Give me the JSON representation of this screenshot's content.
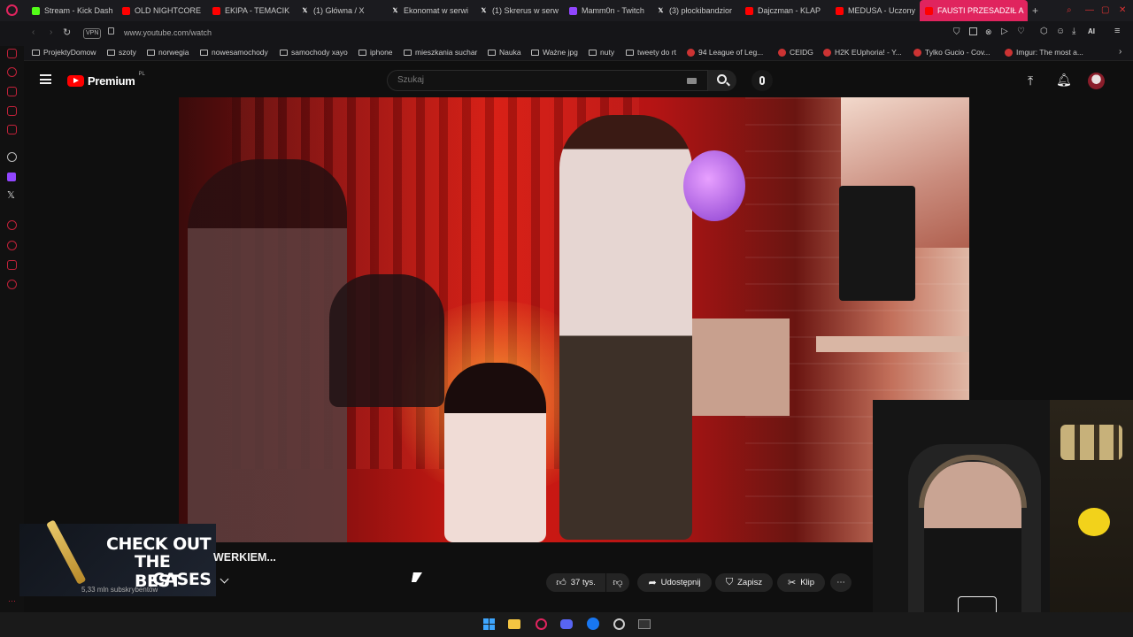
{
  "browser": {
    "tabs": [
      {
        "title": "Stream - Kick Dash",
        "icon": "kick-icon",
        "color": "#53fc18"
      },
      {
        "title": "OLD NIGHTCORE",
        "icon": "youtube-icon",
        "color": "#ff0000"
      },
      {
        "title": "EKIPA - TEMACIK",
        "icon": "youtube-icon",
        "color": "#ff0000"
      },
      {
        "title": "(1) Główna / X",
        "icon": "x-icon",
        "color": "#ffffff"
      },
      {
        "title": "Ekonomat w serwi",
        "icon": "x-icon",
        "color": "#ffffff"
      },
      {
        "title": "(1) Skrerus w serw",
        "icon": "x-icon",
        "color": "#ffffff"
      },
      {
        "title": "Mamm0n - Twitch",
        "icon": "twitch-icon",
        "color": "#9146ff"
      },
      {
        "title": "(3) płockibandzior",
        "icon": "x-icon",
        "color": "#ffffff"
      },
      {
        "title": "Dajczman - KLAP",
        "icon": "youtube-icon",
        "color": "#ff0000"
      },
      {
        "title": "MEDUSA - Uczony",
        "icon": "youtube-icon",
        "color": "#ff0000"
      },
      {
        "title": "FAUSTI PRZESADZIŁ A",
        "icon": "youtube-icon",
        "color": "#ff0000"
      }
    ],
    "new_tab": "+",
    "vpn": "VPN",
    "url": "www.youtube.com/watch",
    "ai_label": "AI",
    "bookmarks": [
      {
        "label": "ProjektyDomow",
        "type": "folder"
      },
      {
        "label": "szoty",
        "type": "folder"
      },
      {
        "label": "norwegia",
        "type": "folder"
      },
      {
        "label": "nowesamochody",
        "type": "folder"
      },
      {
        "label": "samochody xayo",
        "type": "folder"
      },
      {
        "label": "iphone",
        "type": "folder"
      },
      {
        "label": "mieszkania suchar",
        "type": "folder"
      },
      {
        "label": "Nauka",
        "type": "folder"
      },
      {
        "label": "Ważne jpg",
        "type": "folder"
      },
      {
        "label": "nuty",
        "type": "folder"
      },
      {
        "label": "tweety do rt",
        "type": "folder"
      },
      {
        "label": "94 League of Leg...",
        "type": "site"
      },
      {
        "label": "CEIDG",
        "type": "site"
      },
      {
        "label": "H2K EUphoria! - Y...",
        "type": "site"
      },
      {
        "label": "Tylko Gucio - Cov...",
        "type": "site"
      },
      {
        "label": "Imgur: The most a...",
        "type": "site"
      }
    ]
  },
  "youtube": {
    "logo_text": "Premium",
    "logo_region": "PL",
    "search_placeholder": "Szukaj",
    "video_title_fragment": "WERKIEM...",
    "subscribers": "5,33 mln subskrybentów",
    "likes": "37 tys.",
    "share_label": "Udostępnij",
    "save_label": "Zapisz",
    "clip_label": "Klip"
  },
  "overlay_ad": {
    "line1": "CHECK OUT",
    "line2": "THE BEST",
    "line3": "CASES"
  },
  "colors": {
    "accent": "#e0245e",
    "yt_red": "#ff0000",
    "bg": "#0f0f0f"
  }
}
